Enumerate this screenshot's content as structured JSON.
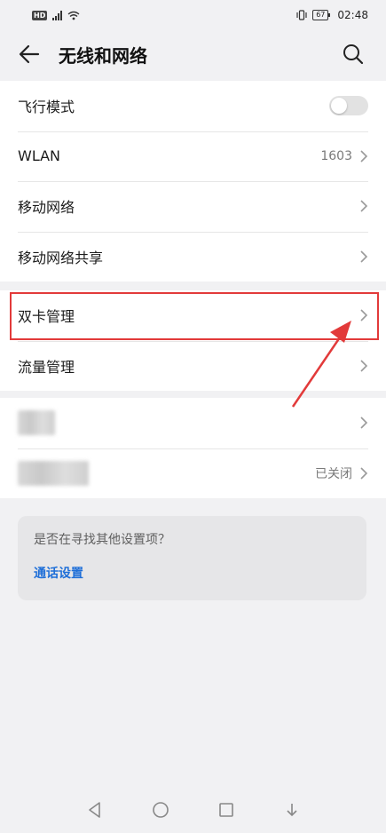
{
  "status_bar": {
    "left_badge": "HD",
    "time": "02:48",
    "battery": "67",
    "icons": [
      "hd-icon",
      "signal-icon",
      "wifi-icon",
      "vibrate-icon",
      "battery-icon"
    ]
  },
  "header": {
    "title": "无线和网络",
    "back_icon": "back-arrow-icon",
    "search_icon": "search-icon"
  },
  "section1": {
    "items": [
      {
        "label": "飞行模式",
        "type": "toggle",
        "toggle_on": false
      },
      {
        "label": "WLAN",
        "value": "1603",
        "type": "chevron"
      },
      {
        "label": "移动网络",
        "type": "chevron"
      },
      {
        "label": "移动网络共享",
        "type": "chevron"
      }
    ]
  },
  "section2": {
    "items": [
      {
        "label": "双卡管理",
        "type": "chevron",
        "highlighted": true
      },
      {
        "label": "流量管理",
        "type": "chevron"
      }
    ]
  },
  "section3": {
    "items": [
      {
        "label": "",
        "type": "chevron",
        "blurred": true
      },
      {
        "label": "",
        "value": "已关闭",
        "type": "chevron",
        "blurred": true
      }
    ]
  },
  "suggest": {
    "question": "是否在寻找其他设置项？",
    "link": "通话设置"
  },
  "nav": {
    "icons": [
      "back-triangle-icon",
      "home-circle-icon",
      "recent-square-icon"
    ]
  },
  "colors": {
    "accent_link": "#1f6fd8",
    "highlight": "#e23a3a"
  }
}
